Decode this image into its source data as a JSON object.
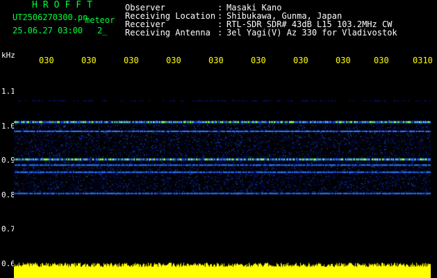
{
  "header": {
    "brand": "HROFFT",
    "filename": "UT2506270300.pn",
    "filename_suffix": "meteor",
    "datetime": "25.06.27 03:00",
    "datetime_suffix": "2_",
    "meta": [
      {
        "key": "Observer",
        "value": "Masaki Kano"
      },
      {
        "key": "Receiving Location",
        "value": "Shibukawa, Gunma, Japan"
      },
      {
        "key": "Receiver",
        "value": "RTL-SDR SDR# 43dB L15 103.2MHz CW"
      },
      {
        "key": "Receiving Antenna",
        "value": "3el Yagi(V) Az 330 for Vladivostok"
      }
    ]
  },
  "axis": {
    "unit": "kHz",
    "x_ticks": [
      "030",
      "030",
      "030",
      "030",
      "030",
      "030",
      "030",
      "030",
      "030",
      "0310"
    ],
    "y_ticks": [
      {
        "label": "1.1",
        "value": 1.1
      },
      {
        "label": "1.0",
        "value": 1.0
      },
      {
        "label": "0.9",
        "value": 0.9
      },
      {
        "label": "0.8",
        "value": 0.8
      },
      {
        "label": "0.7",
        "value": 0.7
      },
      {
        "label": "0.6",
        "value": 0.6
      }
    ],
    "y_range": [
      0.6,
      1.14
    ]
  },
  "spectrogram": {
    "noise_band_khz": [
      0.78,
      0.99
    ],
    "signal_lines_khz": [
      0.985,
      0.96,
      0.88,
      0.865,
      0.845,
      0.785
    ],
    "bright_line_khz": [
      0.985,
      0.88
    ],
    "faint_line_khz": [
      1.045
    ],
    "colors": {
      "background": "#000000",
      "noise": "#0a1a9c",
      "mid": "#2a7bff",
      "hot": "#7dff4a",
      "strip": "#ffff00",
      "text": "#ffffff",
      "brand": "#00ff3a"
    }
  }
}
